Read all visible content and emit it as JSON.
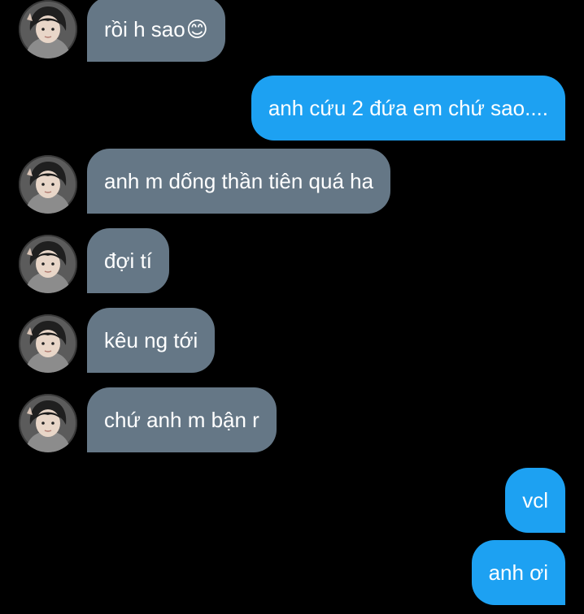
{
  "messages": [
    {
      "direction": "incoming",
      "text": "rồi h sao",
      "emoji": "😊"
    },
    {
      "direction": "outgoing",
      "text": "anh cứu 2 đứa em chứ sao...."
    },
    {
      "direction": "incoming",
      "text": "anh m dống thần tiên quá ha"
    },
    {
      "direction": "incoming",
      "text": "đợi tí"
    },
    {
      "direction": "incoming",
      "text": "kêu ng tới"
    },
    {
      "direction": "incoming",
      "text": "chứ anh m bận r"
    },
    {
      "direction": "outgoing",
      "text": "vcl"
    },
    {
      "direction": "outgoing",
      "text": "anh ơi"
    }
  ],
  "colors": {
    "background": "#000000",
    "incoming_bubble": "#657786",
    "outgoing_bubble": "#1da1f2",
    "text": "#ffffff"
  },
  "icons": {
    "contact_avatar": "avatar-photo",
    "emoji": "smiling-face-emoji"
  }
}
